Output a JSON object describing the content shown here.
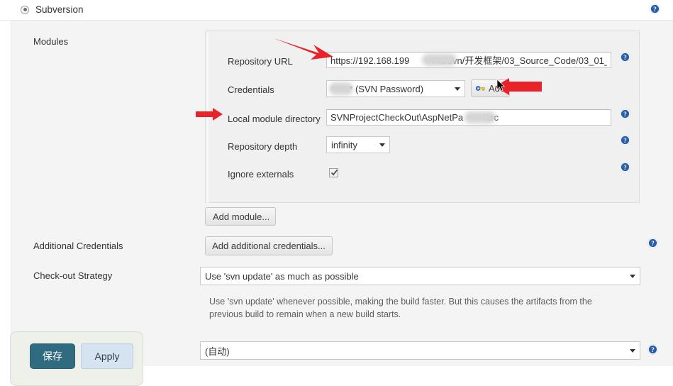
{
  "scm": {
    "option_label": "Subversion",
    "selected": true
  },
  "rows": {
    "modules_label": "Modules",
    "additional_credentials_label": "Additional Credentials",
    "checkout_strategy_label": "Check-out Strategy"
  },
  "module": {
    "repository_url_label": "Repository URL",
    "repository_url_value": "https://192.168.199        443/svn/开发框架/03_Source_Code/03_01_",
    "credentials_label": "Credentials",
    "credentials_value": "****** (SVN Password)",
    "add_credentials_button": "Add",
    "add_credentials_icon": "key-icon",
    "local_module_directory_label": "Local module directory",
    "local_module_directory_value": "SVNProjectCheckOut\\AspNetPa        \\src",
    "repository_depth_label": "Repository depth",
    "repository_depth_value": "infinity",
    "ignore_externals_label": "Ignore externals",
    "ignore_externals_checked": true,
    "add_module_button": "Add module..."
  },
  "additional_credentials": {
    "button_label": "Add additional credentials..."
  },
  "checkout_strategy": {
    "value": "Use 'svn update' as much as possible",
    "description": "Use 'svn update' whenever possible, making the build faster. But this causes the artifacts from the previous build to remain when a new build starts."
  },
  "bottom_select": {
    "value": "(自动)"
  },
  "actions": {
    "save_label": "保存",
    "apply_label": "Apply"
  },
  "icons": {
    "help": "help-icon",
    "caret_down": "chevron-down-icon",
    "check": "check-icon",
    "arrow_annotation": "red-arrow-annotation",
    "mouse_cursor": "mouse-cursor"
  },
  "colors": {
    "help_blue": "#2b5ea8",
    "annotation_red": "#e8242a",
    "save_button_bg": "#316b80",
    "apply_button_bg": "#d6e4f2",
    "panel_bg": "#f0f0f0",
    "page_bg": "#f4f4f4"
  }
}
